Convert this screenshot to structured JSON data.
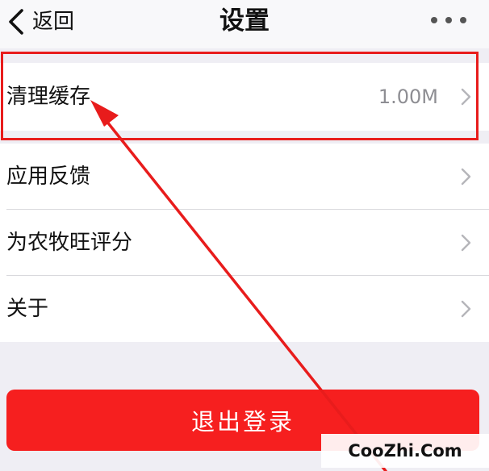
{
  "nav": {
    "back_label": "返回",
    "title": "设置"
  },
  "rows": [
    {
      "label": "清理缓存",
      "value": "1.00M"
    },
    {
      "label": "应用反馈"
    },
    {
      "label": "为农牧旺评分"
    },
    {
      "label": "关于"
    }
  ],
  "logout_label": "退出登录",
  "watermark": "CooZhi.Com",
  "colors": {
    "accent_red": "#f61f1f",
    "annotation_red": "#e81c1c",
    "background": "#efeef4"
  },
  "icons": {
    "back": "chevron-left-icon",
    "more": "more-dots-icon",
    "row": "chevron-right-icon"
  }
}
